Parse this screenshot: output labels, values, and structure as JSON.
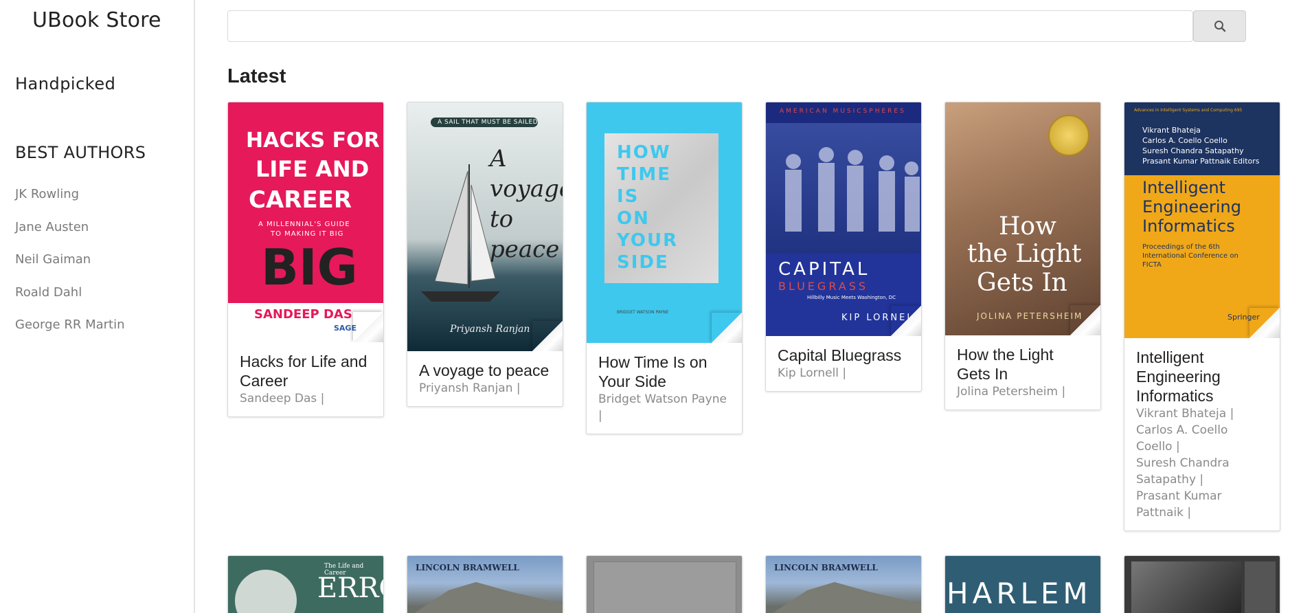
{
  "sidebar": {
    "brand": "UBook Store",
    "handpicked": "Handpicked",
    "best_authors_heading": "BEST AUTHORS",
    "authors": [
      "JK Rowling",
      "Jane Austen",
      "Neil Gaiman",
      "Roald Dahl",
      "George RR Martin"
    ]
  },
  "search": {
    "value": "",
    "placeholder": "",
    "button_icon": "search-icon"
  },
  "section_title": "Latest",
  "books": [
    {
      "title": "Hacks for Life and Career",
      "authors": [
        "Sandeep Das |"
      ],
      "cover": {
        "bg": "#e6195a",
        "lines": [
          "HACKS FOR",
          "LIFE AND",
          "CAREER",
          "A MILLENNIAL'S GUIDE",
          "TO MAKING IT BIG",
          "BIG",
          "SANDEEP DAS",
          "SAGE"
        ]
      }
    },
    {
      "title": "A voyage to peace",
      "authors": [
        "Priyansh Ranjan |"
      ],
      "cover": {
        "bg": "#b9c7c9",
        "lines": [
          "A SAIL THAT MUST BE SAILED",
          "A voyage to peace",
          "Priyansh Ranjan"
        ]
      }
    },
    {
      "title": "How Time Is on Your Side",
      "authors": [
        "Bridget Watson Payne",
        "|"
      ],
      "cover": {
        "bg": "#3ec8ee",
        "lines": [
          "HOW",
          "TIME",
          "IS",
          "ON",
          "YOUR",
          "SIDE",
          "BRIDGET WATSON PAYNE"
        ]
      }
    },
    {
      "title": "Capital Bluegrass",
      "authors": [
        "Kip Lornell |"
      ],
      "cover": {
        "bg": "#22349a",
        "lines": [
          "AMERICAN MUSICSPHERES",
          "CAPITAL",
          "BLUEGRASS",
          "Hillbilly Music Meets Washington, DC",
          "KIP LORNELL"
        ]
      }
    },
    {
      "title": "How the Light Gets In",
      "authors": [
        "Jolina Petersheim |"
      ],
      "cover": {
        "bg": "#8a6a52",
        "lines": [
          "How",
          "the Light",
          "Gets In",
          "JOLINA PETERSHEIM"
        ]
      }
    },
    {
      "title": "Intelligent Engineering Informatics",
      "authors": [
        "Vikrant Bhateja |",
        "Carlos A. Coello",
        "Coello |",
        "Suresh Chandra",
        "Satapathy |",
        "Prasant Kumar",
        "Pattnaik |"
      ],
      "cover": {
        "bg": "#f0a818",
        "lines": [
          "Advances in Intelligent Systems and Computing 695",
          "Vikrant Bhateja",
          "Carlos A. Coello Coello",
          "Suresh Chandra Satapathy",
          "Prasant Kumar Pattnaik Editors",
          "Intelligent",
          "Engineering",
          "Informatics",
          "Proceedings of the 6th International Conference on FICTA",
          "Springer"
        ]
      }
    }
  ],
  "row2_covers": [
    {
      "bg": "#3e6b60",
      "lines": [
        "The Life and Career",
        "ERROL"
      ]
    },
    {
      "bg": "#7a9cc6",
      "lines": [
        "LINCOLN BRAMWELL"
      ]
    },
    {
      "bg": "#8d8d8d",
      "lines": []
    },
    {
      "bg": "#7a9cc6",
      "lines": [
        "LINCOLN BRAMWELL"
      ]
    },
    {
      "bg": "#2f5e74",
      "lines": [
        "HARLEM"
      ]
    },
    {
      "bg": "#3a3a3a",
      "lines": []
    }
  ]
}
